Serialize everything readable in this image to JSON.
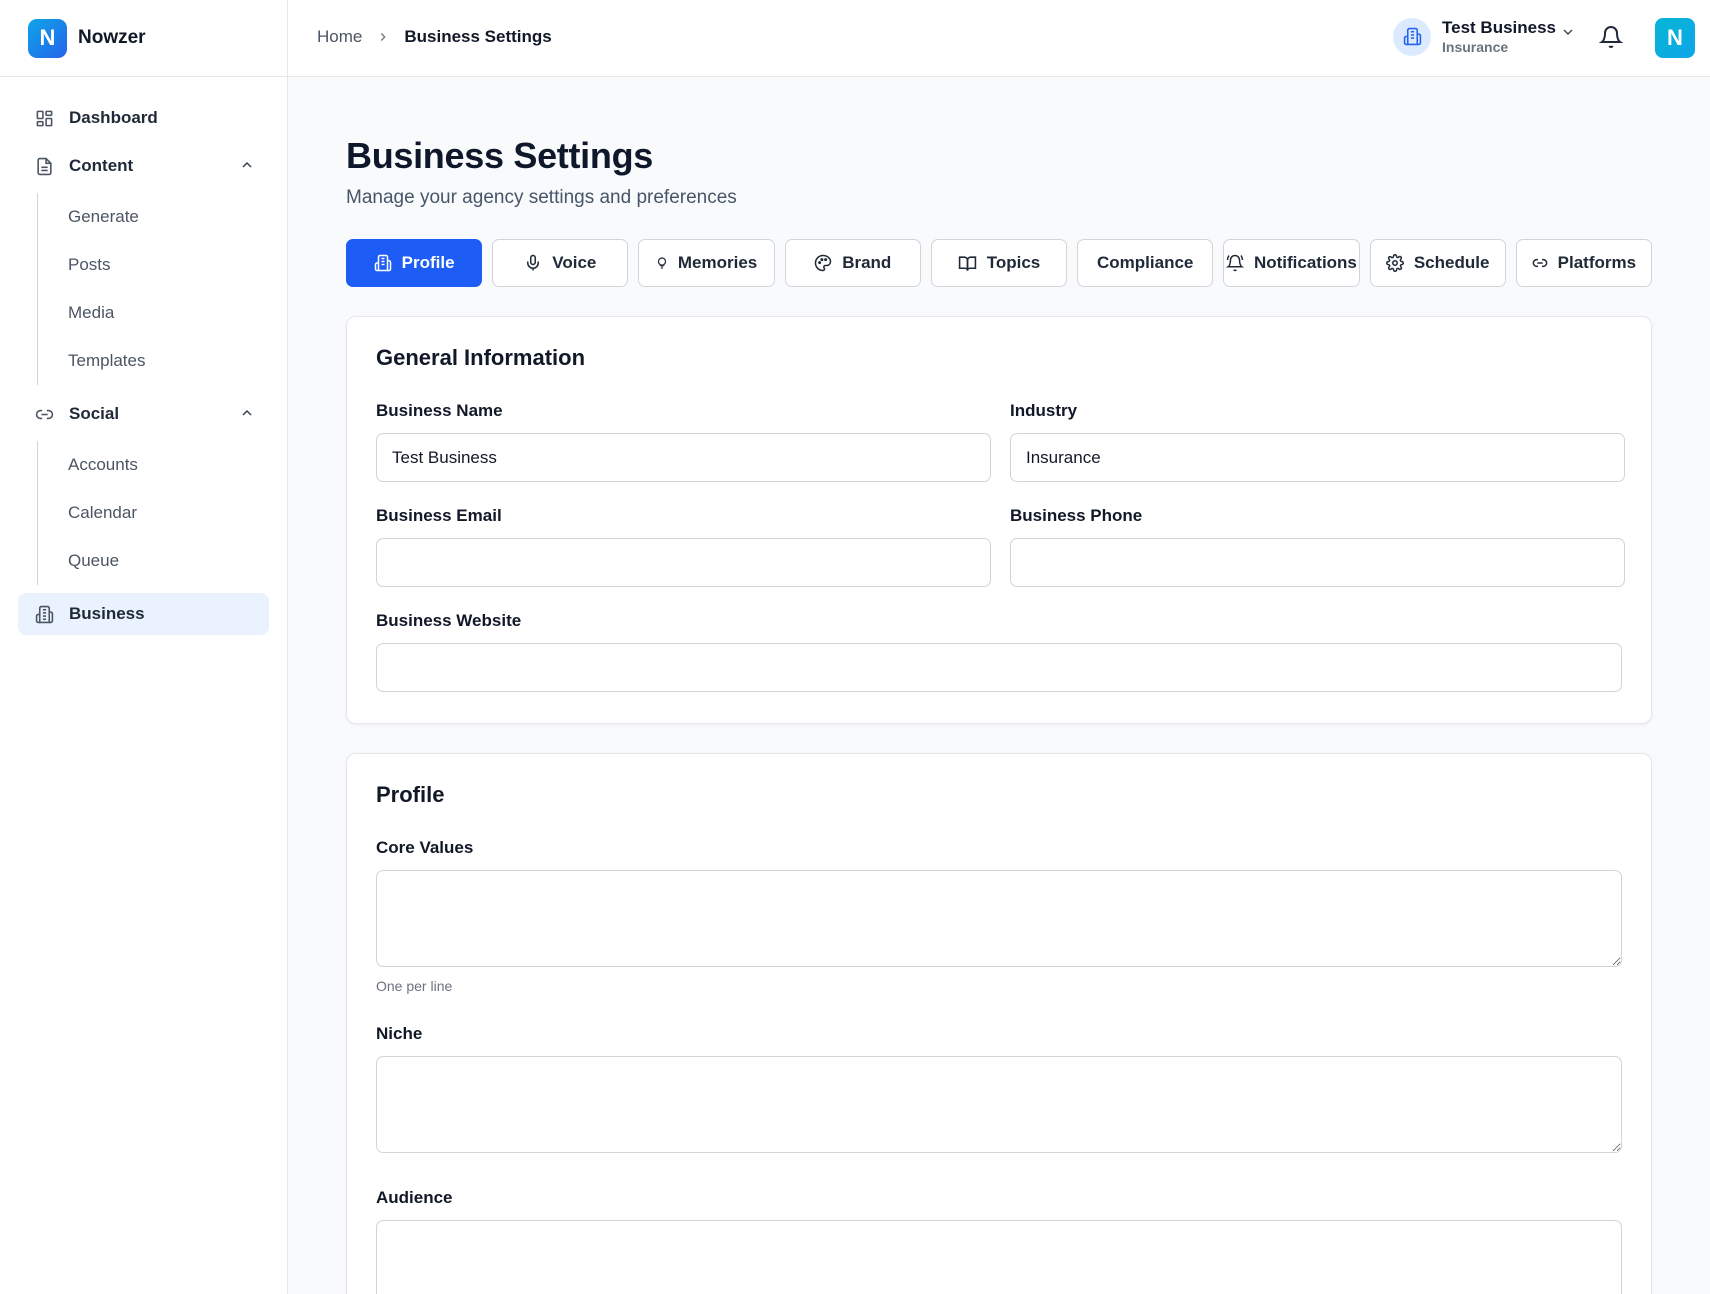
{
  "app": {
    "name": "Nowzer",
    "logo_letter": "N"
  },
  "sidebar": {
    "dashboard": "Dashboard",
    "content": {
      "label": "Content",
      "items": [
        "Generate",
        "Posts",
        "Media",
        "Templates"
      ]
    },
    "social": {
      "label": "Social",
      "items": [
        "Accounts",
        "Calendar",
        "Queue"
      ]
    },
    "business": "Business"
  },
  "header": {
    "breadcrumb": {
      "home": "Home",
      "current": "Business Settings"
    },
    "business_name": "Test Business",
    "business_industry": "Insurance",
    "avatar_letter": "N"
  },
  "page": {
    "title": "Business Settings",
    "subtitle": "Manage your agency settings and preferences"
  },
  "tabs": [
    "Profile",
    "Voice",
    "Memories",
    "Brand",
    "Topics",
    "Compliance",
    "Notifications",
    "Schedule",
    "Platforms"
  ],
  "active_tab": "Profile",
  "general": {
    "title": "General Information",
    "business_name_label": "Business Name",
    "business_name_value": "Test Business",
    "industry_label": "Industry",
    "industry_value": "Insurance",
    "email_label": "Business Email",
    "email_value": "",
    "phone_label": "Business Phone",
    "phone_value": "",
    "website_label": "Business Website",
    "website_value": ""
  },
  "profile": {
    "title": "Profile",
    "core_values_label": "Core Values",
    "core_values_hint": "One per line",
    "niche_label": "Niche",
    "audience_label": "Audience"
  },
  "colors": {
    "accent": "#1d5cf5",
    "active_nav_bg": "#eaf2fe",
    "page_bg": "#f8fafc"
  }
}
